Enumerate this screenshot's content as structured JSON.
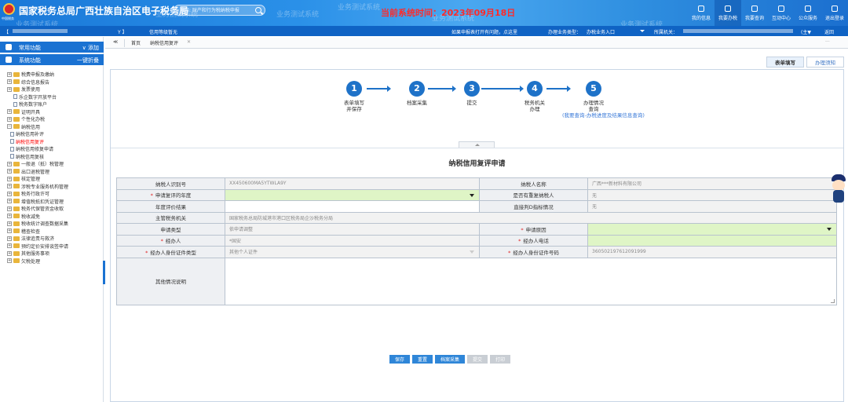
{
  "header": {
    "title": "国家税务总局广西壮族自治区电子税务局",
    "logo_text": "中国税务",
    "search_placeholder": "搜索: 财产和行为税纳税申报",
    "watermarks": [
      "业务测试系统",
      "业务测试系统",
      "业务测试系统",
      "业务测试系统",
      "业务测试系统",
      "业务测试系统"
    ],
    "system_time": "当前系统时间：2023年09月18日",
    "nav": [
      {
        "label": "我的信息",
        "icon": "user-icon"
      },
      {
        "label": "我要办税",
        "icon": "tax-icon"
      },
      {
        "label": "我要查询",
        "icon": "query-icon"
      },
      {
        "label": "互动中心",
        "icon": "chat-icon"
      },
      {
        "label": "公众服务",
        "icon": "service-icon"
      },
      {
        "label": "退出登录",
        "icon": "logout-icon"
      }
    ]
  },
  "subbar": {
    "left_bracket": "【",
    "left_suffix": "Y 】",
    "credit_level": "信用等级暂无",
    "help_text": "如果申报表打开有问题，点这里",
    "business_type_label": "办理业务类型：",
    "business_type_value": "办税业务入口",
    "tax_office_label": "所属机关：",
    "tax_office_suffix": "(主▼",
    "return_label": "返回"
  },
  "sidebar": {
    "common_label": "常用功能",
    "add_label": "添加",
    "system_label": "系统功能",
    "collapse_label": "一键折叠",
    "tree": [
      {
        "label": "税费申报及缴纳",
        "type": "folder",
        "level": 1,
        "expandable": true
      },
      {
        "label": "综合信息报告",
        "type": "folder",
        "level": 1,
        "expandable": true
      },
      {
        "label": "发票使用",
        "type": "folder",
        "level": 1,
        "expandable": true
      },
      {
        "label": "乐企数字开放平台",
        "type": "file",
        "level": 1,
        "expandable": false
      },
      {
        "label": "税务数字账户",
        "type": "file",
        "level": 1,
        "expandable": false
      },
      {
        "label": "证明开具",
        "type": "folder",
        "level": 1,
        "expandable": true
      },
      {
        "label": "个性化办税",
        "type": "folder",
        "level": 1,
        "expandable": true
      },
      {
        "label": "纳税信用",
        "type": "folder",
        "level": 1,
        "expandable": true,
        "expanded": true
      },
      {
        "label": "纳税信用补评",
        "type": "file",
        "level": 2
      },
      {
        "label": "纳税信用复评",
        "type": "file",
        "level": 2,
        "active": true
      },
      {
        "label": "纳税信用修复申请",
        "type": "file",
        "level": 2
      },
      {
        "label": "纳税信用复核",
        "type": "file",
        "level": 2
      },
      {
        "label": "一般退（抵）税管理",
        "type": "folder",
        "level": 1,
        "expandable": true
      },
      {
        "label": "出口退税管理",
        "type": "folder",
        "level": 1,
        "expandable": true
      },
      {
        "label": "核定管理",
        "type": "folder",
        "level": 1,
        "expandable": true
      },
      {
        "label": "涉税专业服务机构管理",
        "type": "folder",
        "level": 1,
        "expandable": true
      },
      {
        "label": "税务行政许可",
        "type": "folder",
        "level": 1,
        "expandable": true
      },
      {
        "label": "增值税抵扣凭证管理",
        "type": "folder",
        "level": 1,
        "expandable": true
      },
      {
        "label": "税务代保管资金收取",
        "type": "folder",
        "level": 1,
        "expandable": true
      },
      {
        "label": "税收减免",
        "type": "folder",
        "level": 1,
        "expandable": true
      },
      {
        "label": "税收统计调查数据采集",
        "type": "folder",
        "level": 1,
        "expandable": true
      },
      {
        "label": "稽查检查",
        "type": "folder",
        "level": 1,
        "expandable": true
      },
      {
        "label": "法律追责与救济",
        "type": "folder",
        "level": 1,
        "expandable": true
      },
      {
        "label": "预约定价安排谈签申请",
        "type": "folder",
        "level": 1,
        "expandable": true
      },
      {
        "label": "其他服务事项",
        "type": "folder",
        "level": 1,
        "expandable": true
      },
      {
        "label": "欠税处理",
        "type": "folder",
        "level": 1,
        "expandable": true
      }
    ]
  },
  "tabs": {
    "back_symbol": "≪",
    "home": "首页",
    "current": "纳税信用复评",
    "close_symbol": "✕",
    "more_symbol": "···"
  },
  "content": {
    "mode_buttons": [
      {
        "label": "表单填写",
        "active": true
      },
      {
        "label": "办理须知",
        "active": false
      }
    ],
    "steps": [
      {
        "num": "1",
        "label": "表单填写\n并保存"
      },
      {
        "num": "2",
        "label": "档案采集"
      },
      {
        "num": "3",
        "label": "提交"
      },
      {
        "num": "4",
        "label": "税务机关\n办理"
      },
      {
        "num": "5",
        "label": "办理情况\n查询",
        "hint": "(我要查询-办税进度及结果信息查询)"
      }
    ],
    "form_title": "纳税信用复评申请",
    "fields": {
      "taxpayer_id_label": "纳税人识别号",
      "taxpayer_id_value": "XX450600MA5YTWLA9Y",
      "taxpayer_name_label": "纳税人名称",
      "taxpayer_name_value": "广西***新材料有限公司",
      "year_label": "申请复评的年度",
      "year_value": "",
      "repeat_label": "是否有重复纳税人",
      "repeat_value": "无",
      "result_label": "年度评价结果",
      "result_value": "",
      "direct_label": "直接判D指标情况",
      "direct_value": "无",
      "authority_label": "主管税务机关",
      "authority_value": "国家税务总局防城港市港口区税务局企沙税务分局",
      "apply_type_label": "申请类型",
      "apply_type_value": "依申请调整",
      "reason_label": "申请原因",
      "reason_value": "",
      "agent_label": "经办人",
      "agent_value": "*国安",
      "agent_phone_label": "经办人电话",
      "agent_phone_value": "",
      "id_type_label": "经办人身份证件类型",
      "id_type_value": "其他个人证件",
      "id_no_label": "经办人身份证件号码",
      "id_no_value": "36050219761​2091999",
      "other_label": "其他情况说明",
      "other_value": ""
    },
    "actions": [
      {
        "label": "保存",
        "enabled": true
      },
      {
        "label": "重置",
        "enabled": true
      },
      {
        "label": "档案采集",
        "enabled": true
      },
      {
        "label": "提交",
        "enabled": false
      },
      {
        "label": "打印",
        "enabled": false
      }
    ]
  },
  "colors": {
    "primary": "#1a72d2",
    "required": "#e02020",
    "editable": "#dff5c6",
    "active_nav": "#ff0000"
  }
}
